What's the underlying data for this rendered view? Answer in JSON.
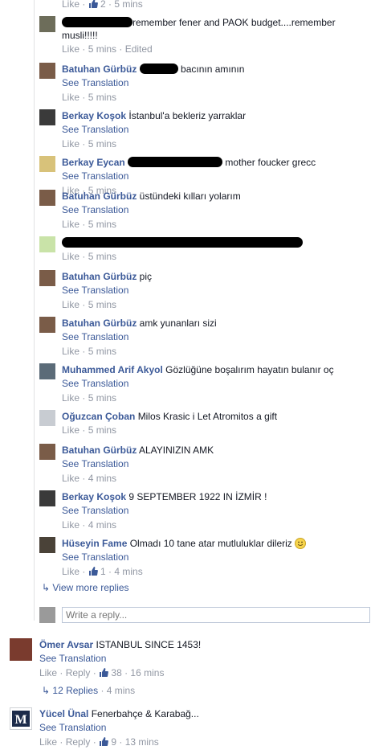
{
  "top_fragment": {
    "like": "Like",
    "count": "2",
    "time": "5 mins"
  },
  "replies": [
    {
      "name": "",
      "text": "remember fener and PAOK budget....remember",
      "text2": "musli!!!!!",
      "translate": "",
      "like": "Like",
      "time": "5 mins",
      "extra": "Edited"
    },
    {
      "name": "Batuhan Gürbüz",
      "text": "bacının amının",
      "translate": "See Translation",
      "like": "Like",
      "time": "5 mins"
    },
    {
      "name": "Berkay Koşok",
      "text": "İstanbul'a bekleriz yarraklar",
      "translate": "See Translation",
      "like": "Like",
      "time": "5 mins"
    },
    {
      "name": "Berkay Eycan",
      "text": "mother foucker grecc",
      "translate": "See Translation",
      "like": "Like",
      "time": "5 mins"
    },
    {
      "name": "Batuhan Gürbüz",
      "text": "üstündeki kılları yolarım",
      "translate": "See Translation",
      "like": "Like",
      "time": "5 mins"
    },
    {
      "name": "",
      "text": "",
      "translate": "",
      "like": "Like",
      "time": "5 mins"
    },
    {
      "name": "Batuhan Gürbüz",
      "text": "piç",
      "translate": "See Translation",
      "like": "Like",
      "time": "5 mins"
    },
    {
      "name": "Batuhan Gürbüz",
      "text": "amk yunanları sizi",
      "translate": "See Translation",
      "like": "Like",
      "time": "5 mins"
    },
    {
      "name": "Muhammed Arif Akyol",
      "text": "Gözlüğüne boşalırım hayatın bulanır oç",
      "translate": "See Translation",
      "like": "Like",
      "time": "5 mins"
    },
    {
      "name": "Oğuzcan Çoban",
      "text": "Milos Krasic i Let Atromitos a gift",
      "translate": "",
      "like": "Like",
      "time": "5 mins"
    },
    {
      "name": "Batuhan Gürbüz",
      "text": "ALAYINIZIN AMK",
      "translate": "See Translation",
      "like": "Like",
      "time": "4 mins"
    },
    {
      "name": "Berkay Koşok",
      "text": "9 SEPTEMBER 1922 IN İZMİR !",
      "translate": "See Translation",
      "like": "Like",
      "time": "4 mins"
    },
    {
      "name": "Hüseyin Fame",
      "text": "Olmadı 10 tane atar mutluluklar dileriz",
      "translate": "See Translation",
      "like": "Like",
      "likes": "1",
      "time": "4 mins"
    }
  ],
  "view_more": "View more replies",
  "reply_placeholder": "Write a reply...",
  "comments": [
    {
      "name": "Ömer Avsar",
      "text": "ISTANBUL SINCE 1453!",
      "translate": "See Translation",
      "like": "Like",
      "reply": "Reply",
      "likes": "38",
      "time": "16 mins",
      "replies_label": "12 Replies",
      "replies_time": "4 mins"
    },
    {
      "name": "Yücel Ünal",
      "text": "Fenerbahçe & Karabağ...",
      "translate": "See Translation",
      "like": "Like",
      "reply": "Reply",
      "likes": "9",
      "time": "13 mins"
    }
  ],
  "colors": {
    "link": "#3b5998",
    "meta": "#9197a3",
    "text": "#141823"
  }
}
